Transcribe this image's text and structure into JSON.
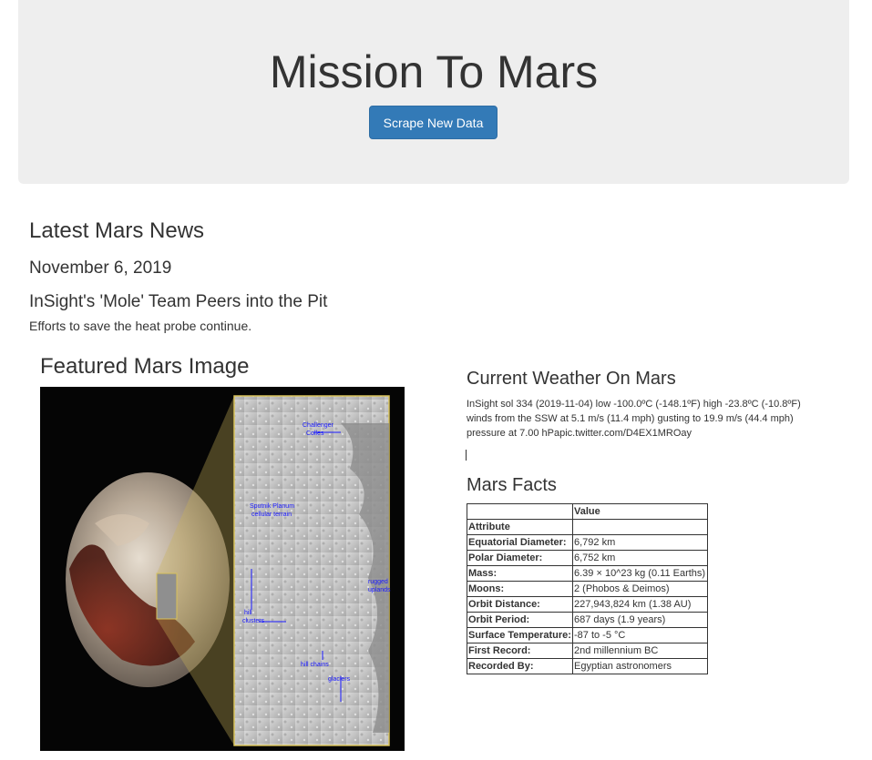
{
  "header": {
    "title": "Mission To Mars",
    "scrape_button": "Scrape New Data"
  },
  "news": {
    "heading": "Latest Mars News",
    "date": "November 6, 2019",
    "title": "InSight's 'Mole' Team Peers into the Pit",
    "teaser": "Efforts to save the heat probe continue."
  },
  "featured_image": {
    "heading": "Featured Mars Image",
    "labels": [
      "Challenger Colles",
      "Sputnik Planum cellular terrain",
      "rugged uplands",
      "hill clusters",
      "hill chains",
      "glaciers"
    ]
  },
  "weather": {
    "heading": "Current Weather On Mars",
    "text": "InSight sol 334 (2019-11-04) low -100.0ºC (-148.1ºF) high -23.8ºC (-10.8ºF) winds from the SSW at 5.1 m/s (11.4 mph) gusting to 19.9 m/s (44.4 mph) pressure at 7.00 hPapic.twitter.com/D4EX1MROay"
  },
  "facts": {
    "heading": "Mars Facts",
    "header_value": "Value",
    "header_attribute": "Attribute",
    "rows": [
      {
        "key": "Equatorial Diameter:",
        "value": "6,792 km"
      },
      {
        "key": "Polar Diameter:",
        "value": "6,752 km"
      },
      {
        "key": "Mass:",
        "value": "6.39 × 10^23 kg (0.11 Earths)"
      },
      {
        "key": "Moons:",
        "value": "2 (Phobos & Deimos)"
      },
      {
        "key": "Orbit Distance:",
        "value": "227,943,824 km (1.38 AU)"
      },
      {
        "key": "Orbit Period:",
        "value": "687 days (1.9 years)"
      },
      {
        "key": "Surface Temperature:",
        "value": "-87 to -5 °C"
      },
      {
        "key": "First Record:",
        "value": "2nd millennium BC"
      },
      {
        "key": "Recorded By:",
        "value": "Egyptian astronomers"
      }
    ]
  },
  "colors": {
    "jumbotron_bg": "#eeeeee",
    "button_bg": "#337ab7",
    "text": "#333333"
  }
}
